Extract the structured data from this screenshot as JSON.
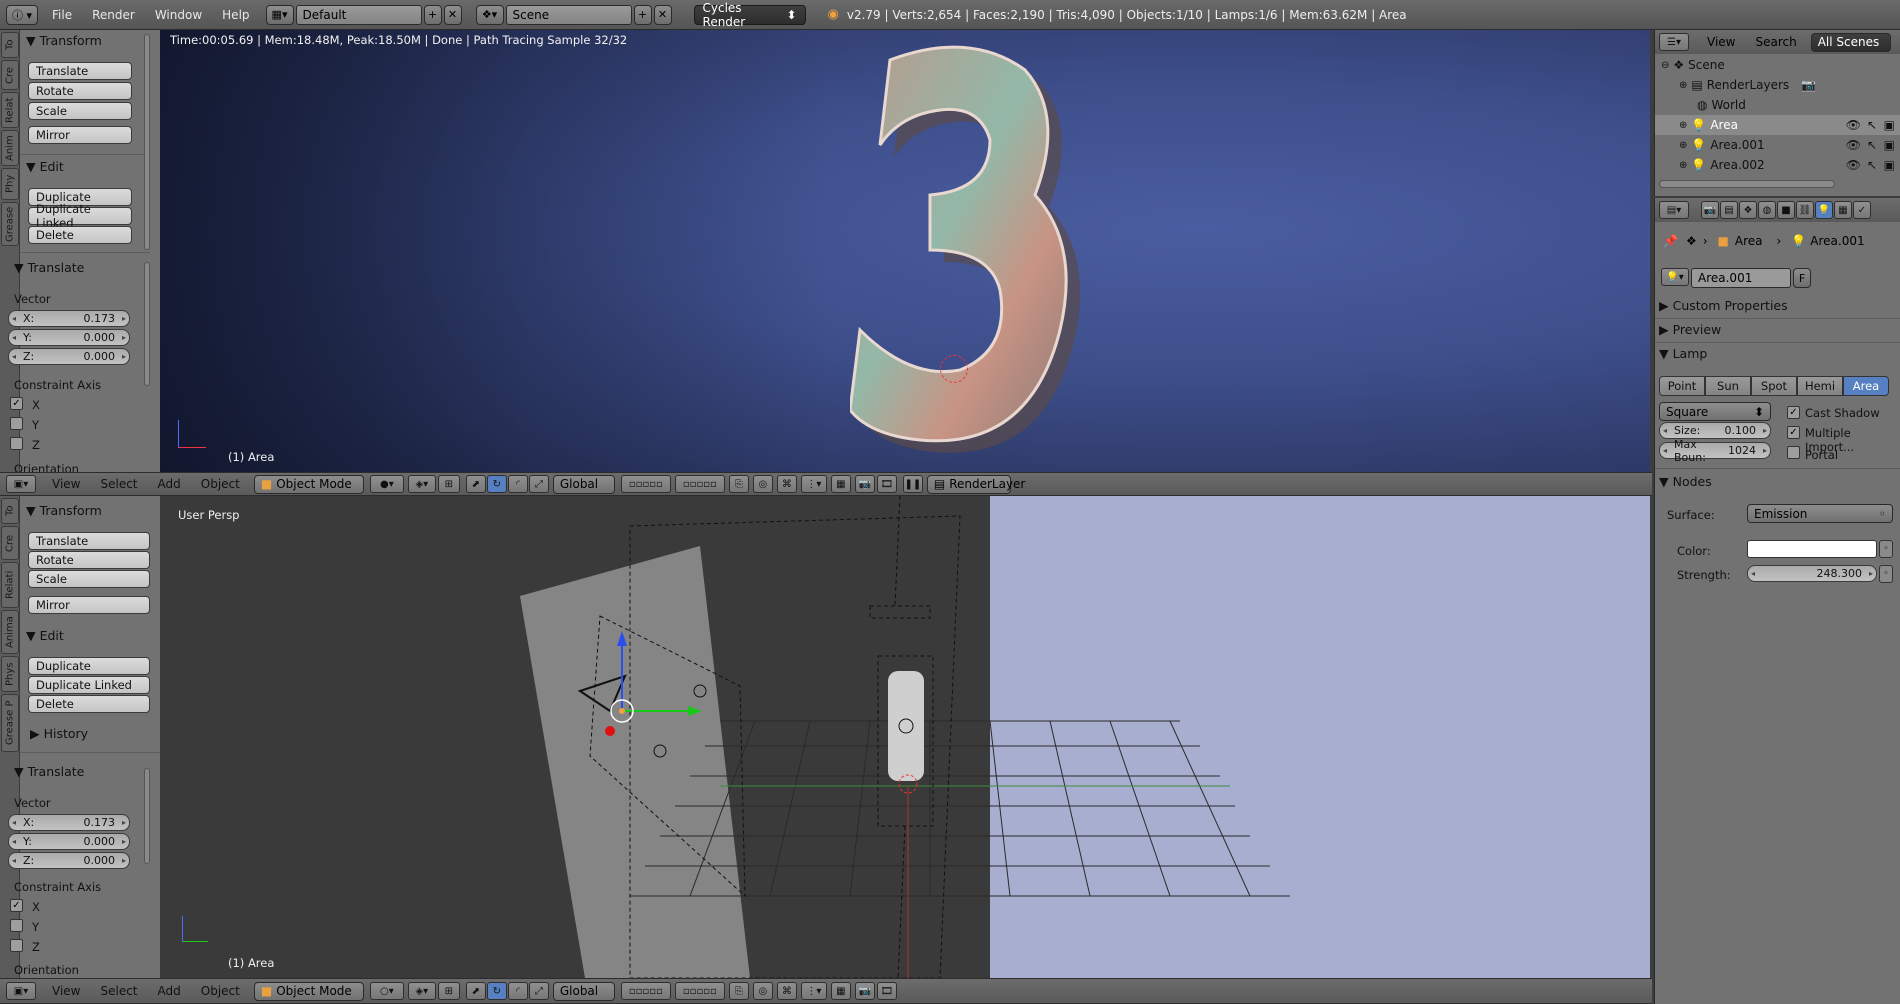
{
  "topbar": {
    "menus": [
      "File",
      "Render",
      "Window",
      "Help"
    ],
    "layout": "Default",
    "scene": "Scene",
    "engine": "Cycles Render",
    "stats": "v2.79 | Verts:2,654 | Faces:2,190 | Tris:4,090 | Objects:1/10 | Lamps:1/6 | Mem:63.62M | Area"
  },
  "shelf_tabs": [
    "To",
    "Cre",
    "Relat",
    "Anim",
    "Phy",
    "Grease"
  ],
  "shelf_tabs_bottom": [
    "To",
    "Cre",
    "Relati",
    "Anima",
    "Phys",
    "Grease P"
  ],
  "shelf": {
    "transform_title": "Transform",
    "translate": "Translate",
    "rotate": "Rotate",
    "scale": "Scale",
    "mirror": "Mirror",
    "edit_title": "Edit",
    "duplicate": "Duplicate",
    "duplicate_linked": "Duplicate Linked",
    "delete": "Delete",
    "history_title": "History",
    "operator_title": "Translate",
    "vector_label": "Vector",
    "x_label": "X:",
    "x_value": "0.173",
    "y_label": "Y:",
    "y_value": "0.000",
    "z_label": "Z:",
    "z_value": "0.000",
    "constraint_label": "Constraint Axis",
    "ax_x": "X",
    "ax_y": "Y",
    "ax_z": "Z",
    "orientation_label": "Orientation"
  },
  "render_view": {
    "status": "Time:00:05.69 | Mem:18.48M, Peak:18.50M | Done | Path Tracing Sample 32/32",
    "digit": "3",
    "object_label": "(1) Area"
  },
  "viewport": {
    "persp_label": "User Persp",
    "object_label": "(1) Area"
  },
  "vp_header": {
    "menus": [
      "View",
      "Select",
      "Add",
      "Object"
    ],
    "mode": "Object Mode",
    "orientation": "Global",
    "render_layer": "RenderLayer"
  },
  "outliner": {
    "header_items": [
      "View",
      "Search"
    ],
    "filter": "All Scenes",
    "items": [
      "Scene",
      "RenderLayers",
      "World",
      "Area",
      "Area.001",
      "Area.002"
    ]
  },
  "props": {
    "breadcrumb_1": "Area",
    "breadcrumb_2": "Area.001",
    "datablock": "Area.001",
    "fake_user": "F",
    "custom_properties": "Custom Properties",
    "preview": "Preview",
    "lamp": "Lamp",
    "lamp_types": [
      "Point",
      "Sun",
      "Spot",
      "Hemi",
      "Area"
    ],
    "shape": "Square",
    "size_label": "Size:",
    "size_value": "0.100",
    "max_bounces_label": "Max Boun:",
    "max_bounces_value": "1024",
    "cast_shadow": "Cast Shadow",
    "multiple_importance": "Multiple Import...",
    "portal": "Portal",
    "nodes": "Nodes",
    "surface_label": "Surface:",
    "surface_value": "Emission",
    "color_label": "Color:",
    "strength_label": "Strength:",
    "strength_value": "248.300"
  },
  "colors": {
    "accent_blue": "#5680c2",
    "render_bg": "#3e4f8c",
    "viewport_bg": "#3b3b3b",
    "right_panel_bg": "#a8aed0"
  }
}
